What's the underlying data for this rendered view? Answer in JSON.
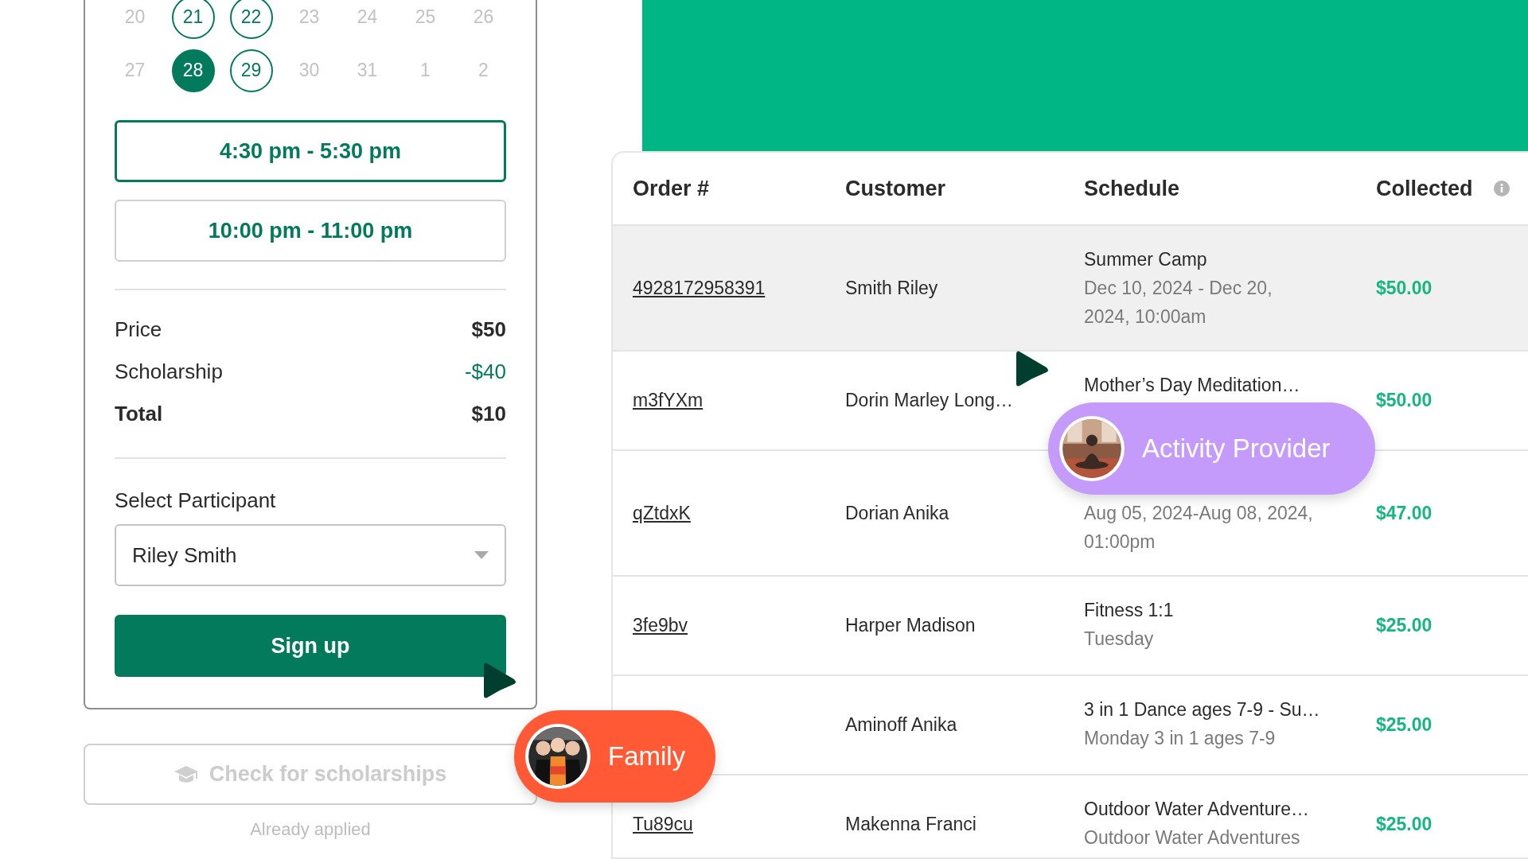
{
  "calendar": {
    "weeks": [
      [
        {
          "day": "20",
          "available": false,
          "selected": false
        },
        {
          "day": "21",
          "available": true,
          "selected": false
        },
        {
          "day": "22",
          "available": true,
          "selected": false
        },
        {
          "day": "23",
          "available": false,
          "selected": false
        },
        {
          "day": "24",
          "available": false,
          "selected": false
        },
        {
          "day": "25",
          "available": false,
          "selected": false
        },
        {
          "day": "26",
          "available": false,
          "selected": false
        }
      ],
      [
        {
          "day": "27",
          "available": false,
          "selected": false
        },
        {
          "day": "28",
          "available": true,
          "selected": true
        },
        {
          "day": "29",
          "available": true,
          "selected": false
        },
        {
          "day": "30",
          "available": false,
          "selected": false
        },
        {
          "day": "31",
          "available": false,
          "selected": false
        },
        {
          "day": "1",
          "available": false,
          "selected": false
        },
        {
          "day": "2",
          "available": false,
          "selected": false
        }
      ]
    ]
  },
  "time_slots": [
    {
      "label": "4:30 pm - 5:30 pm",
      "selected": true
    },
    {
      "label": "10:00 pm - 11:00 pm",
      "selected": false
    }
  ],
  "pricing": [
    {
      "kind": "normal",
      "label": "Price",
      "value": "$50"
    },
    {
      "kind": "discount",
      "label": "Scholarship",
      "value": "-$40"
    },
    {
      "kind": "total",
      "label": "Total",
      "value": "$10"
    }
  ],
  "participant": {
    "label": "Select Participant",
    "value": "Riley Smith"
  },
  "signup_button": "Sign up",
  "scholarship_button": {
    "label": "Check for scholarships",
    "disabled": true,
    "note": "Already applied"
  },
  "table": {
    "columns": [
      "Order #",
      "Customer",
      "Schedule",
      "Collected"
    ],
    "rows": [
      {
        "order": "4928172958391",
        "customer": "Smith Riley",
        "schedule": "Summer Camp",
        "detail": "Dec 10, 2024 - Dec 20, 2024, 10:00am",
        "collected": "$50.00",
        "highlighted": true
      },
      {
        "order": "m3fYXm",
        "customer": "Dorin Marley Long…",
        "schedule": "Mother’s Day Meditation…",
        "collected": "$50.00",
        "highlighted": false
      },
      {
        "order": "qZtdxK",
        "customer": "Dorian Anika",
        "detail": "Aug 05, 2024-Aug 08, 2024, 01:00pm",
        "collected": "$47.00",
        "highlighted": false
      },
      {
        "order": "3fe9bv",
        "customer": "Harper Madison",
        "schedule": "Fitness 1:1",
        "detail": "Tuesday",
        "collected": "$25.00",
        "highlighted": false
      },
      {
        "customer": "Aminoff Anika",
        "schedule": "3 in 1 Dance ages 7-9 - Su…",
        "detail": "Monday 3 in 1 ages 7-9",
        "collected": "$25.00",
        "highlighted": false
      },
      {
        "order": "Tu89cu",
        "customer": "Makenna Franci",
        "schedule": "Outdoor Water Adventure…",
        "detail": "Outdoor Water Adventures",
        "collected": "$25.00",
        "highlighted": false
      }
    ]
  },
  "badges": [
    {
      "kind": "provider",
      "label": "Activity Provider",
      "color": "#c49bfa"
    },
    {
      "kind": "family",
      "label": "Family",
      "color": "#ff5a35"
    }
  ]
}
